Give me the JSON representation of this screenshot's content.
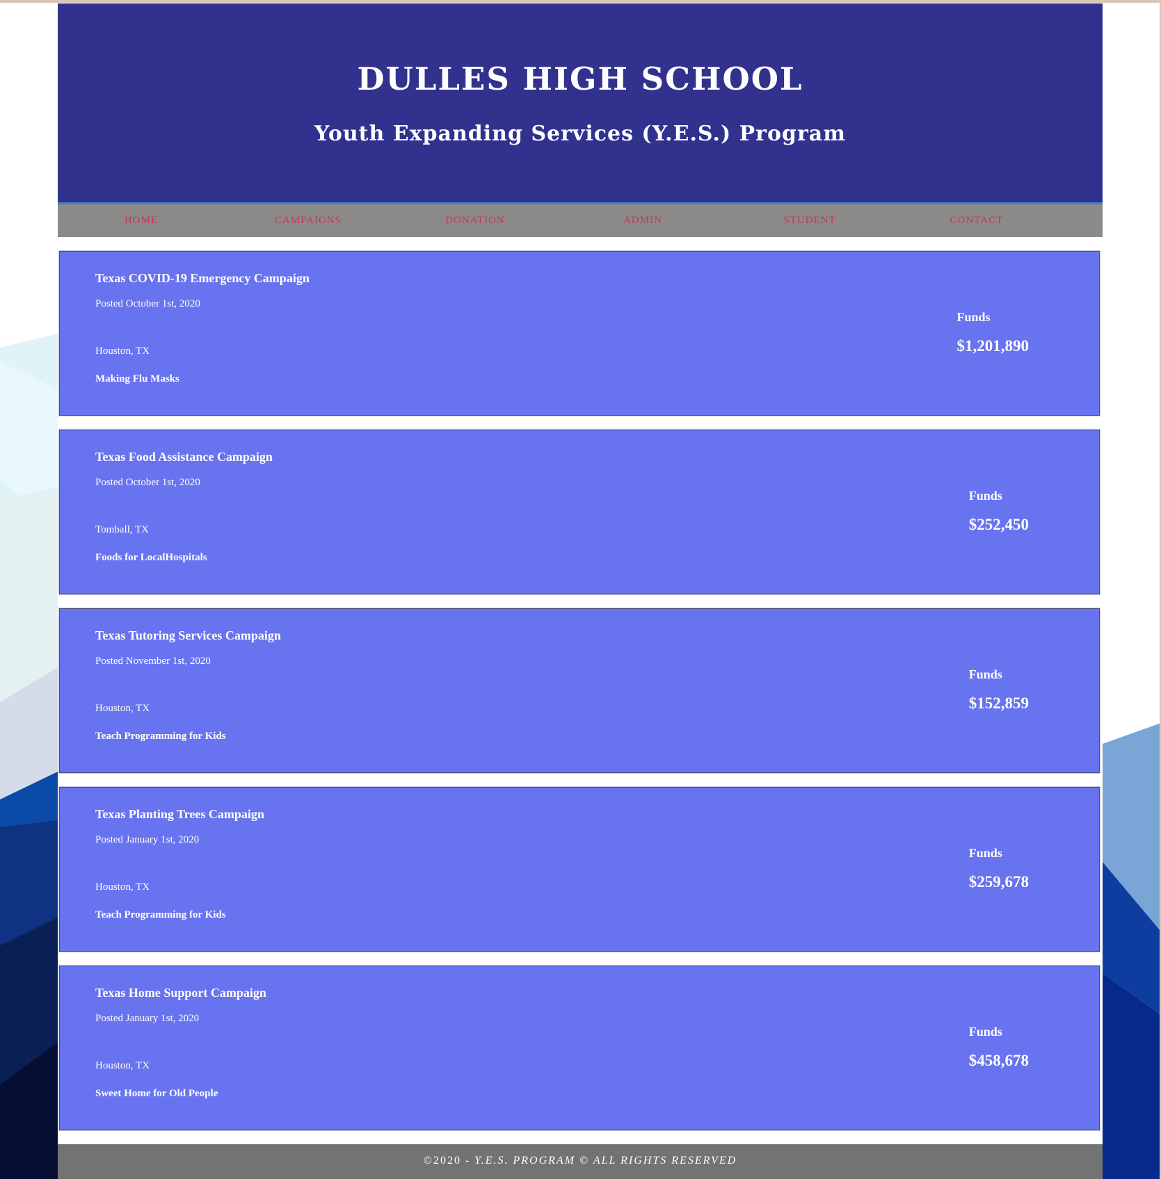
{
  "header": {
    "school_name": "DULLES HIGH SCHOOL",
    "program_name": "Youth Expanding Services (Y.E.S.) Program"
  },
  "nav": {
    "items": [
      {
        "label": "HOME"
      },
      {
        "label": "CAMPAIGNS"
      },
      {
        "label": "DONATION"
      },
      {
        "label": "ADMIN"
      },
      {
        "label": "STUDENT"
      },
      {
        "label": "CONTACT"
      }
    ]
  },
  "campaigns": [
    {
      "title": "Texas COVID-19 Emergency Campaign",
      "posted": "Posted October 1st, 2020",
      "location": "Houston, TX",
      "description": "Making Flu Masks",
      "funds_label": "Funds",
      "funds": "$1,201,890"
    },
    {
      "title": "Texas Food Assistance Campaign",
      "posted": "Posted October 1st, 2020",
      "location": "Tomball, TX",
      "description": "Foods for LocalHospitals",
      "funds_label": "Funds",
      "funds": "$252,450"
    },
    {
      "title": "Texas Tutoring Services Campaign",
      "posted": "Posted November 1st, 2020",
      "location": "Houston, TX",
      "description": "Teach Programming for Kids",
      "funds_label": "Funds",
      "funds": "$152,859"
    },
    {
      "title": "Texas Planting Trees Campaign",
      "posted": "Posted January 1st, 2020",
      "location": "Houston, TX",
      "description": "Teach Programming for Kids",
      "funds_label": "Funds",
      "funds": "$259,678"
    },
    {
      "title": "Texas Home Support Campaign",
      "posted": "Posted January 1st, 2020",
      "location": "Houston, TX",
      "description": "Sweet Home for Old People",
      "funds_label": "Funds",
      "funds": "$458,678"
    }
  ],
  "footer": {
    "prefix": "©2020 - ",
    "text": "Y.E.S. PROGRAM © ALL RIGHTS RESERVED"
  },
  "colors": {
    "header_bg": "#30328e",
    "nav_bg": "#8c8a88",
    "nav_link": "#c0395a",
    "card_bg": "#6873ef",
    "footer_bg": "#737373"
  }
}
